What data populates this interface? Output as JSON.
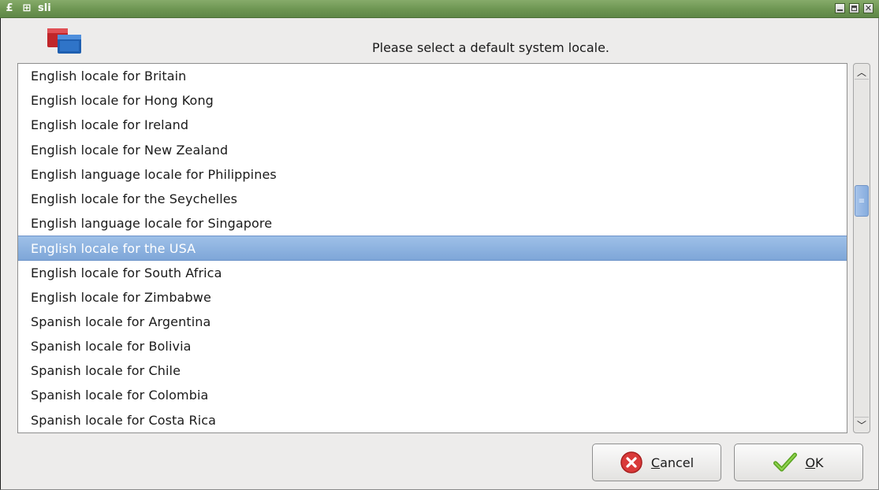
{
  "window": {
    "title": "sli",
    "menu_icon_glyph": "£",
    "app_glyph": "⊞"
  },
  "header": {
    "prompt": "Please select a default system locale."
  },
  "locales": {
    "items": [
      "English locale for Britain",
      "English locale for Hong Kong",
      "English locale for Ireland",
      "English locale for New Zealand",
      "English language locale for Philippines",
      "English locale for the Seychelles",
      "English language locale for Singapore",
      "English locale for the USA",
      "English locale for South Africa",
      "English locale for Zimbabwe",
      "Spanish locale for Argentina",
      "Spanish locale for Bolivia",
      "Spanish locale for Chile",
      "Spanish locale for Colombia",
      "Spanish locale for Costa Rica"
    ],
    "selected_index": 7
  },
  "buttons": {
    "cancel": {
      "mnemonic": "C",
      "rest": "ancel"
    },
    "ok": {
      "mnemonic": "O",
      "rest": "K"
    }
  },
  "icons": {
    "title_left": "window-menu-icon",
    "title_second": "sticky-icon",
    "minimize": "minimize-icon",
    "maximize": "maximize-icon",
    "close": "close-icon",
    "app": "locale-app-icon",
    "cancel": "cancel-icon",
    "ok": "checkmark-icon"
  },
  "colors": {
    "titlebar": "#6d9552",
    "selection": "#86acde",
    "cancel_icon": "#d93a3a",
    "ok_icon": "#6bb52b"
  }
}
